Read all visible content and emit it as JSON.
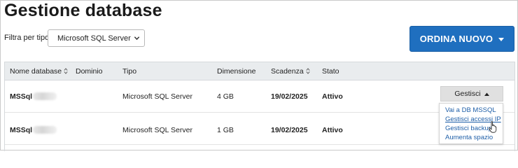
{
  "page": {
    "title": "Gestione database"
  },
  "filter": {
    "label": "Filtra per tipo:",
    "selected": "Microsoft SQL Server"
  },
  "order_button": {
    "label": "ORDINA NUOVO"
  },
  "table": {
    "headers": {
      "name": "Nome database",
      "domain": "Dominio",
      "type": "Tipo",
      "size": "Dimensione",
      "expiry": "Scadenza",
      "status": "Stato"
    },
    "rows": [
      {
        "name": "MSSql",
        "domain": "",
        "type": "Microsoft SQL Server",
        "size": "4 GB",
        "expiry": "19/02/2025",
        "status": "Attivo",
        "action": "Gestisci"
      },
      {
        "name": "MSSql",
        "domain": "",
        "type": "Microsoft SQL Server",
        "size": "1 GB",
        "expiry": "19/02/2025",
        "status": "Attivo"
      }
    ]
  },
  "manage_menu": {
    "items": [
      "Vai a DB MSSQL",
      "Gestisci accessi IP",
      "Gestisci backup",
      "Aumenta spazio"
    ]
  },
  "colors": {
    "primary": "#1f6fbf",
    "link": "#1f5fa8",
    "header_bg": "#e9ecee"
  }
}
